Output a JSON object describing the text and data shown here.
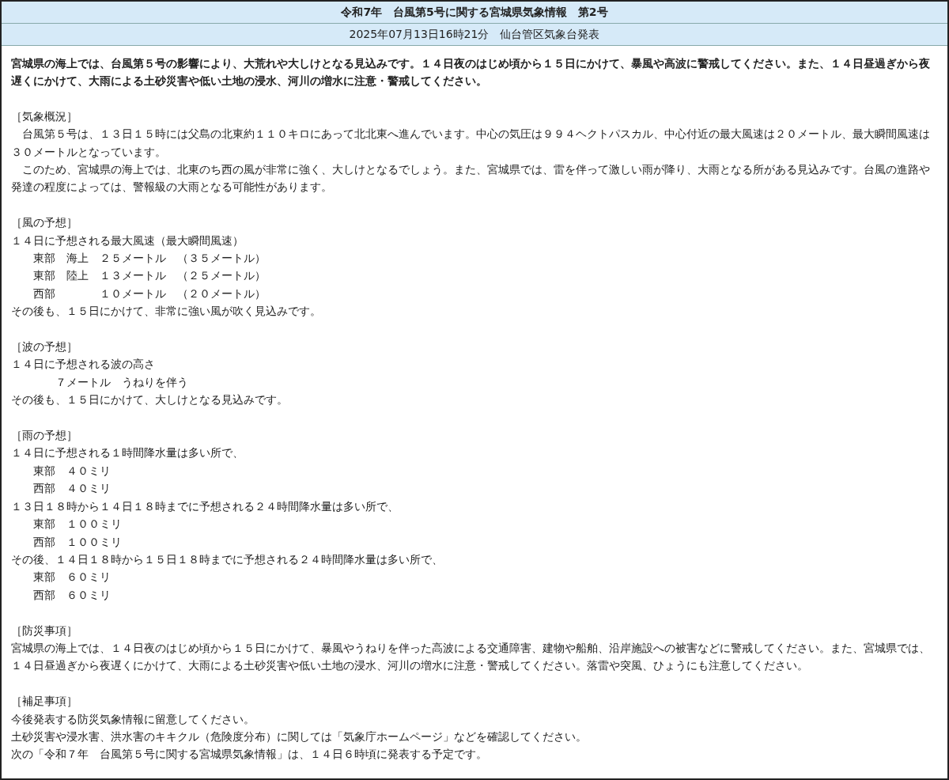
{
  "title": "令和7年　台風第5号に関する宮城県気象情報　第2号",
  "issued": "2025年07月13日16時21分　仙台管区気象台発表",
  "headline": "宮城県の海上では、台風第５号の影響により、大荒れや大しけとなる見込みです。１４日夜のはじめ頃から１５日にかけて、暴風や高波に警戒してください。また、１４日昼過ぎから夜遅くにかけて、大雨による土砂災害や低い土地の浸水、河川の増水に注意・警戒してください。",
  "sections": [
    {
      "heading": "［気象概況］",
      "lines": [
        {
          "text": "　台風第５号は、１３日１５時には父島の北東約１１０キロにあって北北東へ進んでいます。中心の気圧は９９４ヘクトパスカル、中心付近の最大風速は２０メートル、最大瞬間風速は３０メートルとなっています。"
        },
        {
          "text": "　このため、宮城県の海上では、北東のち西の風が非常に強く、大しけとなるでしょう。また、宮城県では、雷を伴って激しい雨が降り、大雨となる所がある見込みです。台風の進路や発達の程度によっては、警報級の大雨となる可能性があります。"
        }
      ]
    },
    {
      "heading": "［風の予想］",
      "lines": [
        {
          "text": "１４日に予想される最大風速（最大瞬間風速）"
        },
        {
          "text": "　　東部　海上　２５メートル　（３５メートル）"
        },
        {
          "text": "　　東部　陸上　１３メートル　（２５メートル）"
        },
        {
          "text": "　　西部　　　　１０メートル　（２０メートル）"
        },
        {
          "text": "その後も、１５日にかけて、非常に強い風が吹く見込みです。"
        }
      ]
    },
    {
      "heading": "［波の予想］",
      "lines": [
        {
          "text": "１４日に予想される波の高さ"
        },
        {
          "text": "　　　　７メートル　うねりを伴う"
        },
        {
          "text": "その後も、１５日にかけて、大しけとなる見込みです。"
        }
      ]
    },
    {
      "heading": "［雨の予想］",
      "lines": [
        {
          "text": "１４日に予想される１時間降水量は多い所で、"
        },
        {
          "text": "　　東部　４０ミリ"
        },
        {
          "text": "　　西部　４０ミリ"
        },
        {
          "text": "１３日１８時から１４日１８時までに予想される２４時間降水量は多い所で、"
        },
        {
          "text": "　　東部　１００ミリ"
        },
        {
          "text": "　　西部　１００ミリ"
        },
        {
          "text": "その後、１４日１８時から１５日１８時までに予想される２４時間降水量は多い所で、"
        },
        {
          "text": "　　東部　６０ミリ"
        },
        {
          "text": "　　西部　６０ミリ"
        }
      ]
    },
    {
      "heading": "［防災事項］",
      "lines": [
        {
          "text": "宮城県の海上では、１４日夜のはじめ頃から１５日にかけて、暴風やうねりを伴った高波による交通障害、建物や船舶、沿岸施設への被害などに警戒してください。また、宮城県では、１４日昼過ぎから夜遅くにかけて、大雨による土砂災害や低い土地の浸水、河川の増水に注意・警戒してください。落雷や突風、ひょうにも注意してください。"
        }
      ]
    },
    {
      "heading": "［補足事項］",
      "lines": [
        {
          "text": "今後発表する防災気象情報に留意してください。"
        },
        {
          "text": "土砂災害や浸水害、洪水害のキキクル（危険度分布）に関しては「気象庁ホームページ」などを確認してください。"
        },
        {
          "text": "次の「令和７年　台風第５号に関する宮城県気象情報」は、１４日６時頃に発表する予定です。"
        }
      ]
    }
  ]
}
